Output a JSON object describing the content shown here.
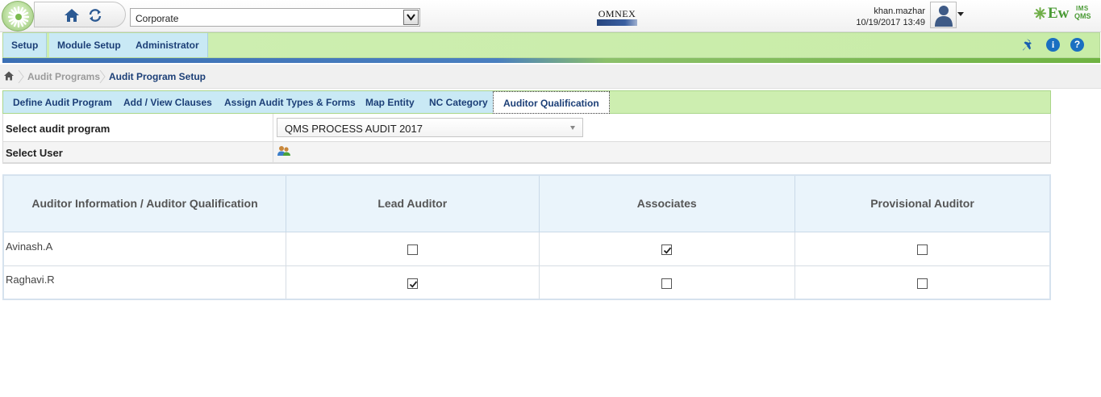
{
  "header": {
    "organization": "Corporate",
    "center_logo_text": "OMNEX",
    "user": {
      "name": "khan.mazhar",
      "datetime": "10/19/2017 13:49"
    },
    "brand": {
      "name": "Ew",
      "suffix_top": "IMS",
      "suffix_bottom": "QMS"
    },
    "icons": [
      "app-logo-icon",
      "home-icon",
      "refresh-icon",
      "user-avatar-icon",
      "pin-icon",
      "info-icon",
      "help-icon"
    ]
  },
  "menu": {
    "items": [
      "Setup",
      "Module Setup",
      "Administrator"
    ],
    "info_label": "i",
    "help_label": "?"
  },
  "breadcrumb": {
    "items": [
      "Audit Programs",
      "Audit Program Setup"
    ]
  },
  "tabs": {
    "items": [
      "Define Audit Program",
      "Add / View Clauses",
      "Assign Audit Types & Forms",
      "Map Entity",
      "NC Category",
      "Auditor Qualification"
    ],
    "active": "Auditor Qualification"
  },
  "form": {
    "program_label": "Select audit program",
    "program_value": "QMS PROCESS AUDIT 2017",
    "user_label": "Select User"
  },
  "table": {
    "columns": [
      "Auditor Information / Auditor Qualification",
      "Lead Auditor",
      "Associates",
      "Provisional Auditor"
    ],
    "rows": [
      {
        "name": "Avinash.A",
        "lead_auditor": false,
        "associates": true,
        "provisional_auditor": false
      },
      {
        "name": "Raghavi.R",
        "lead_auditor": true,
        "associates": false,
        "provisional_auditor": false
      }
    ]
  },
  "colors": {
    "menu_green": "#cdeeb0",
    "menu_blue": "#c9e9f5",
    "text_navy": "#1c3f77",
    "header_cell": "#eaf4fb",
    "brand_green": "#4a9a35",
    "icon_blue": "#1a6fc1"
  }
}
